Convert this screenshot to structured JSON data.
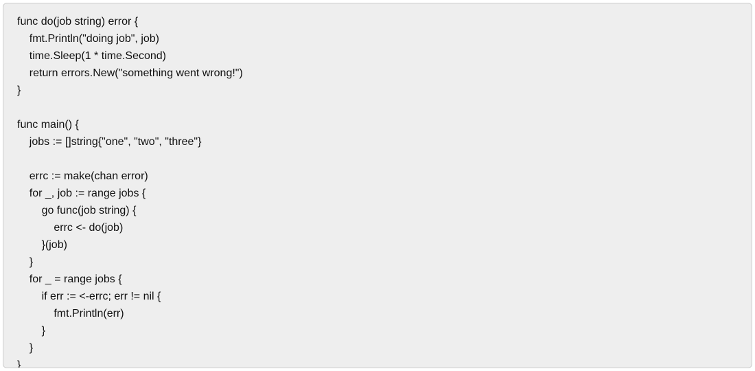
{
  "code": {
    "lines": [
      "func do(job string) error {",
      "    fmt.Println(\"doing job\", job)",
      "    time.Sleep(1 * time.Second)",
      "    return errors.New(\"something went wrong!\")",
      "}",
      "",
      "func main() {",
      "    jobs := []string{\"one\", \"two\", \"three\"}",
      "",
      "    errc := make(chan error)",
      "    for _, job := range jobs {",
      "        go func(job string) {",
      "            errc <- do(job)",
      "        }(job)",
      "    }",
      "    for _ = range jobs {",
      "        if err := <-errc; err != nil {",
      "            fmt.Println(err)",
      "        }",
      "    }",
      "}"
    ]
  }
}
